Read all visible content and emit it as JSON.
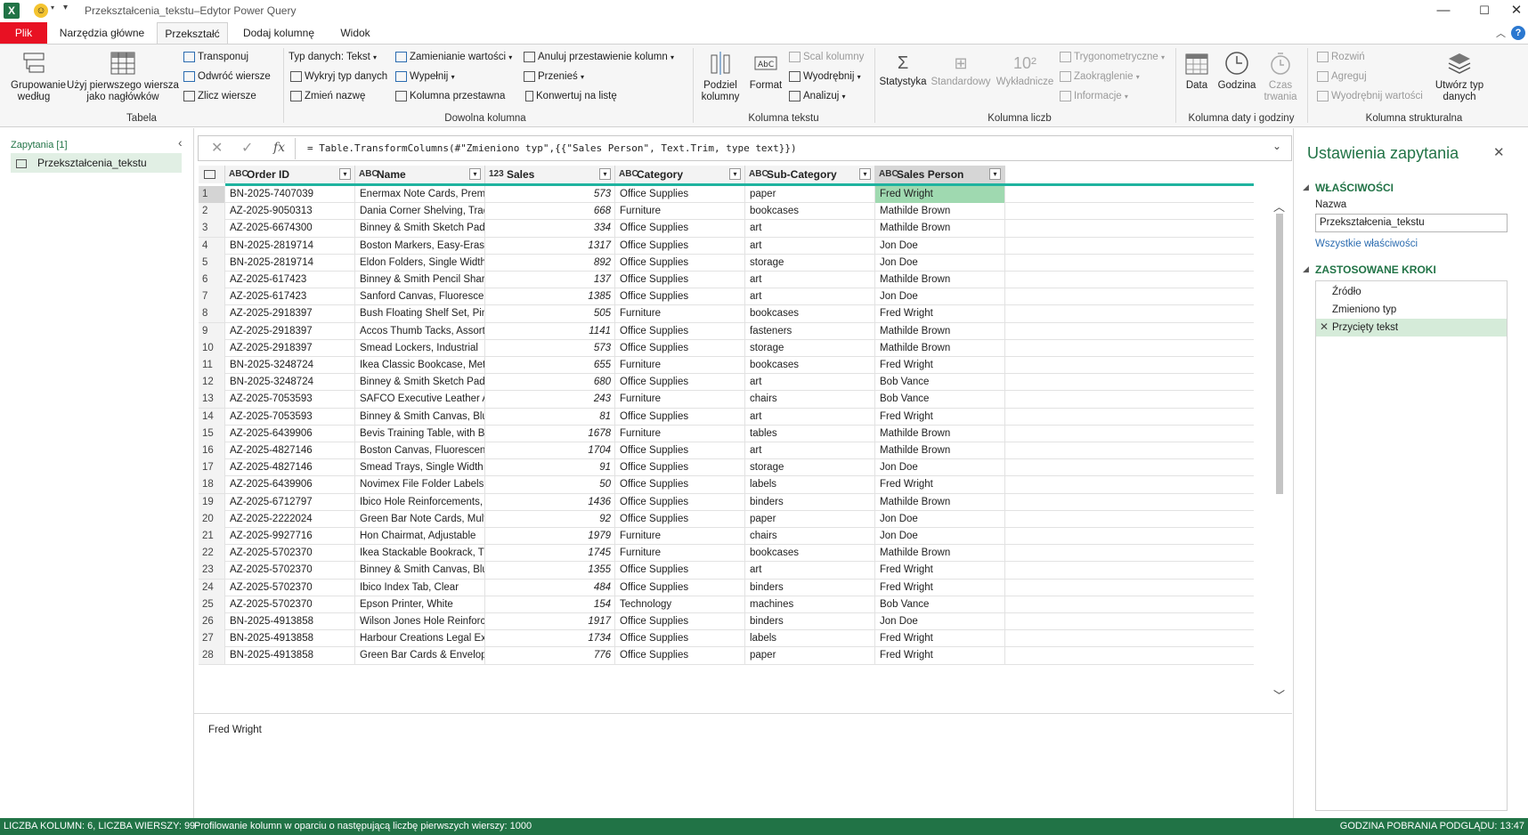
{
  "window": {
    "title": "Przekształcenia_tekstu–Edytor Power Query"
  },
  "tabs": [
    "Plik",
    "Narzędzia główne",
    "Przekształć",
    "Dodaj kolumnę",
    "Widok"
  ],
  "ribbon": {
    "group_by": "Grupowanie według",
    "first_row_headers": "Użyj pierwszego wiersza jako nagłówków",
    "table_small": [
      "Transponuj",
      "Odwróć wiersze",
      "Zlicz wiersze"
    ],
    "table_group": "Tabela",
    "any_col_a": [
      "Typ danych: Tekst",
      "Wykryj typ danych",
      "Zmień nazwę"
    ],
    "any_col_b": [
      "Zamienianie wartości",
      "Wypełnij",
      "Kolumna przestawna"
    ],
    "any_col_c": [
      "Anuluj przestawienie kolumn",
      "Przenieś",
      "Konwertuj na listę"
    ],
    "any_col_group": "Dowolna kolumna",
    "split": "Podziel kolumny",
    "format": "Format",
    "text_small": [
      "Scal kolumny",
      "Wyodrębnij",
      "Analizuj"
    ],
    "text_group": "Kolumna tekstu",
    "stats": "Statystyka",
    "standard": "Standardowy",
    "scientific": "Wykładnicze",
    "num_small": [
      "Trygonometryczne",
      "Zaokrąglenie",
      "Informacje"
    ],
    "num_group": "Kolumna liczb",
    "date": "Data",
    "time": "Godzina",
    "duration": "Czas trwania",
    "date_group": "Kolumna daty i godziny",
    "struct_small": [
      "Rozwiń",
      "Agreguj",
      "Wyodrębnij wartości"
    ],
    "create_type": "Utwórz typ danych",
    "struct_group": "Kolumna strukturalna"
  },
  "queries": {
    "title": "Zapytania [1]",
    "item": "Przekształcenia_tekstu"
  },
  "formula": {
    "fx": "fx",
    "text": "= Table.TransformColumns(#\"Zmieniono typ\",{{\"Sales Person\", Text.Trim, type text}})"
  },
  "columns": [
    {
      "type": "ABC",
      "name": "Order ID"
    },
    {
      "type": "ABC",
      "name": "Name"
    },
    {
      "type": "123",
      "name": "Sales"
    },
    {
      "type": "ABC",
      "name": "Category"
    },
    {
      "type": "ABC",
      "name": "Sub-Category"
    },
    {
      "type": "ABC",
      "name": "Sales Person"
    }
  ],
  "rows": [
    [
      "1",
      "BN-2025-7407039",
      "Enermax Note Cards, Premium",
      "573",
      "Office Supplies",
      "paper",
      "Fred Wright"
    ],
    [
      "2",
      "AZ-2025-9050313",
      "Dania Corner Shelving, Traditional",
      "668",
      "Furniture",
      "bookcases",
      "Mathilde Brown"
    ],
    [
      "3",
      "AZ-2025-6674300",
      "Binney & Smith Sketch Pad, Easy-Erase",
      "334",
      "Office Supplies",
      "art",
      "Mathilde Brown"
    ],
    [
      "4",
      "BN-2025-2819714",
      "Boston Markers, Easy-Erase",
      "1317",
      "Office Supplies",
      "art",
      "Jon Doe"
    ],
    [
      "5",
      "BN-2025-2819714",
      "Eldon Folders, Single Width",
      "892",
      "Office Supplies",
      "storage",
      "Jon Doe"
    ],
    [
      "6",
      "AZ-2025-617423",
      "Binney & Smith Pencil Sharpener, Water Color",
      "137",
      "Office Supplies",
      "art",
      "Mathilde Brown"
    ],
    [
      "7",
      "AZ-2025-617423",
      "Sanford Canvas, Fluorescent",
      "1385",
      "Office Supplies",
      "art",
      "Jon Doe"
    ],
    [
      "8",
      "AZ-2025-2918397",
      "Bush Floating Shelf Set, Pine",
      "505",
      "Furniture",
      "bookcases",
      "Fred Wright"
    ],
    [
      "9",
      "AZ-2025-2918397",
      "Accos Thumb Tacks, Assorted Sizes",
      "1141",
      "Office Supplies",
      "fasteners",
      "Mathilde Brown"
    ],
    [
      "10",
      "AZ-2025-2918397",
      "Smead Lockers, Industrial",
      "573",
      "Office Supplies",
      "storage",
      "Mathilde Brown"
    ],
    [
      "11",
      "BN-2025-3248724",
      "Ikea Classic Bookcase, Metal",
      "655",
      "Furniture",
      "bookcases",
      "Fred Wright"
    ],
    [
      "12",
      "BN-2025-3248724",
      "Binney & Smith Sketch Pad, Blue",
      "680",
      "Office Supplies",
      "art",
      "Bob Vance"
    ],
    [
      "13",
      "AZ-2025-7053593",
      "SAFCO Executive Leather Armchair, Red",
      "243",
      "Furniture",
      "chairs",
      "Bob Vance"
    ],
    [
      "14",
      "AZ-2025-7053593",
      "Binney & Smith Canvas, Blue",
      "81",
      "Office Supplies",
      "art",
      "Fred Wright"
    ],
    [
      "15",
      "AZ-2025-6439906",
      "Bevis Training Table, with Bottom Storage",
      "1678",
      "Furniture",
      "tables",
      "Mathilde Brown"
    ],
    [
      "16",
      "AZ-2025-4827146",
      "Boston Canvas, Fluorescent",
      "1704",
      "Office Supplies",
      "art",
      "Mathilde Brown"
    ],
    [
      "17",
      "AZ-2025-4827146",
      "Smead Trays, Single Width",
      "91",
      "Office Supplies",
      "storage",
      "Jon Doe"
    ],
    [
      "18",
      "AZ-2025-6439906",
      "Novimex File Folder Labels, Alphabetical",
      "50",
      "Office Supplies",
      "labels",
      "Fred Wright"
    ],
    [
      "19",
      "AZ-2025-6712797",
      "Ibico Hole Reinforcements, Recycled",
      "1436",
      "Office Supplies",
      "binders",
      "Mathilde Brown"
    ],
    [
      "20",
      "AZ-2025-2222024",
      "Green Bar Note Cards, Multicolor",
      "92",
      "Office Supplies",
      "paper",
      "Jon Doe"
    ],
    [
      "21",
      "AZ-2025-9927716",
      "Hon Chairmat, Adjustable",
      "1979",
      "Furniture",
      "chairs",
      "Jon Doe"
    ],
    [
      "22",
      "AZ-2025-5702370",
      "Ikea Stackable Bookrack, Traditional",
      "1745",
      "Furniture",
      "bookcases",
      "Mathilde Brown"
    ],
    [
      "23",
      "AZ-2025-5702370",
      "Binney & Smith Canvas, Blue",
      "1355",
      "Office Supplies",
      "art",
      "Fred Wright"
    ],
    [
      "24",
      "AZ-2025-5702370",
      "Ibico Index Tab, Clear",
      "484",
      "Office Supplies",
      "binders",
      "Fred Wright"
    ],
    [
      "25",
      "AZ-2025-5702370",
      "Epson Printer, White",
      "154",
      "Technology",
      "machines",
      "Bob Vance"
    ],
    [
      "26",
      "BN-2025-4913858",
      "Wilson Jones Hole Reinforcements, Durable",
      "1917",
      "Office Supplies",
      "binders",
      "Jon Doe"
    ],
    [
      "27",
      "BN-2025-4913858",
      "Harbour Creations Legal Exhibit Labels, Laser Printer Compatible",
      "1734",
      "Office Supplies",
      "labels",
      "Fred Wright"
    ],
    [
      "28",
      "BN-2025-4913858",
      "Green Bar Cards & Envelopes, Multicolor",
      "776",
      "Office Supplies",
      "paper",
      "Fred Wright"
    ]
  ],
  "preview": {
    "value": "Fred Wright"
  },
  "settings": {
    "title": "Ustawienia zapytania",
    "props_title": "WŁAŚCIWOŚCI",
    "name_label": "Nazwa",
    "name_value": "Przekształcenia_tekstu",
    "all_props": "Wszystkie właściwości",
    "steps_title": "ZASTOSOWANE KROKI",
    "steps": [
      "Źródło",
      "Zmieniono typ",
      "Przycięty tekst"
    ]
  },
  "status": {
    "left": "LICZBA KOLUMN: 6, LICZBA WIERSZY: 99",
    "profile": "Profilowanie kolumn w oparciu o następującą liczbę pierwszych wierszy: 1000",
    "right": "GODZINA POBRANIA PODGLĄDU: 13:47"
  },
  "colors": {
    "accent": "#217346",
    "file_tab": "#e81123",
    "selected_cell": "#9fd9b0",
    "teal_bar": "#1fb39f"
  }
}
